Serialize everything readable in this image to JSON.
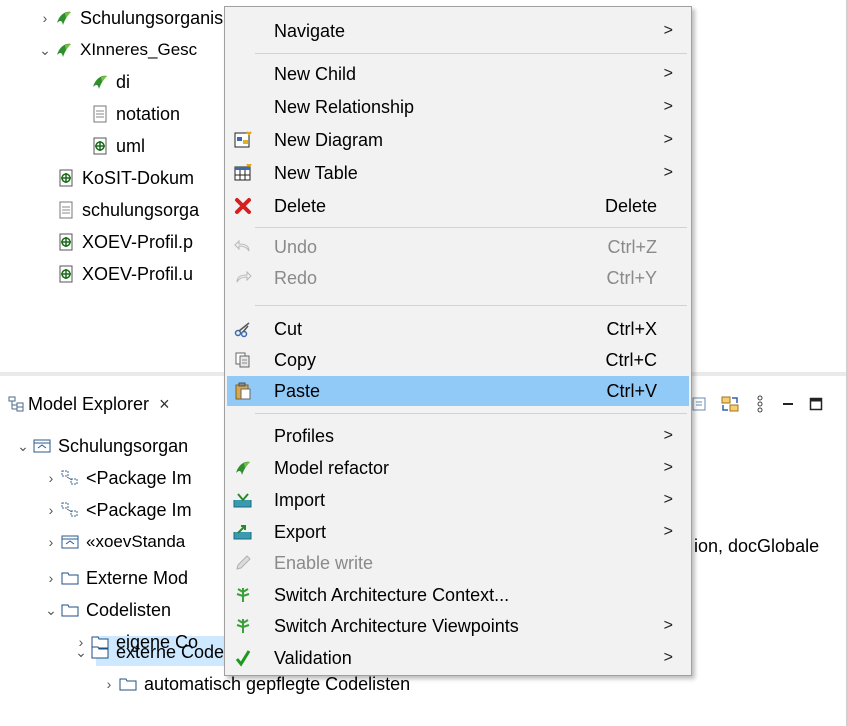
{
  "top_tree": [
    {
      "twisty": "›",
      "icon": "papyrus-icon",
      "label": "Schulungsorganisation"
    },
    {
      "twisty": "⌄",
      "icon": "papyrus-icon",
      "label": "XInneres_Gesc"
    },
    {
      "twisty": "",
      "icon": "papyrus-icon",
      "label": "di"
    },
    {
      "twisty": "",
      "icon": "text-file-icon",
      "label": "notation"
    },
    {
      "twisty": "",
      "icon": "uml-file-icon",
      "label": "uml"
    },
    {
      "twisty": "",
      "icon": "uml-file-icon",
      "label": "KoSIT-Dokum"
    },
    {
      "twisty": "",
      "icon": "text-file-icon",
      "label": "schulungsorga"
    },
    {
      "twisty": "",
      "icon": "uml-file-icon",
      "label": "XOEV-Profil.p"
    },
    {
      "twisty": "",
      "icon": "uml-file-icon",
      "label": "XOEV-Profil.u"
    }
  ],
  "model_explorer": {
    "tab_label": "Model Explorer",
    "close_glyph": "×",
    "tree": [
      {
        "twisty": "⌄",
        "icon": "model-icon",
        "label": "Schulungsorgan"
      },
      {
        "twisty": "›",
        "icon": "package-import-icon",
        "label": "<Package Im"
      },
      {
        "twisty": "›",
        "icon": "package-import-icon",
        "label": "<Package Im"
      },
      {
        "twisty": "›",
        "icon": "model-icon",
        "label": "«xoevStanda"
      },
      {
        "twisty": "›",
        "icon": "folder-icon",
        "label": "Externe Mod"
      },
      {
        "twisty": "⌄",
        "icon": "folder-icon",
        "label": "Codelisten"
      },
      {
        "twisty": "›",
        "icon": "folder-icon",
        "label": "eigene Co"
      },
      {
        "twisty": "⌄",
        "icon": "folder-icon",
        "label": "externe Codelisten"
      },
      {
        "twisty": "›",
        "icon": "folder-icon",
        "label": "automatisch gepflegte Codelisten"
      }
    ],
    "right_overflow_text": "ion, docGlobale"
  },
  "context_menu": {
    "items": [
      {
        "label": "Navigate",
        "accel": "",
        "submenu": true,
        "icon": "",
        "disabled": false
      },
      {
        "label": "New Child",
        "accel": "",
        "submenu": true,
        "icon": "",
        "disabled": false
      },
      {
        "label": "New Relationship",
        "accel": "",
        "submenu": true,
        "icon": "",
        "disabled": false
      },
      {
        "label": "New Diagram",
        "accel": "",
        "submenu": true,
        "icon": "new-diagram-icon",
        "disabled": false
      },
      {
        "label": "New Table",
        "accel": "",
        "submenu": true,
        "icon": "new-table-icon",
        "disabled": false
      },
      {
        "label": "Delete",
        "accel": "Delete",
        "submenu": false,
        "icon": "delete-icon",
        "disabled": false
      },
      {
        "label": "Undo",
        "accel": "Ctrl+Z",
        "submenu": false,
        "icon": "undo-icon",
        "disabled": true
      },
      {
        "label": "Redo",
        "accel": "Ctrl+Y",
        "submenu": false,
        "icon": "redo-icon",
        "disabled": true
      },
      {
        "label": "Cut",
        "accel": "Ctrl+X",
        "submenu": false,
        "icon": "cut-icon",
        "disabled": false
      },
      {
        "label": "Copy",
        "accel": "Ctrl+C",
        "submenu": false,
        "icon": "copy-icon",
        "disabled": false
      },
      {
        "label": "Paste",
        "accel": "Ctrl+V",
        "submenu": false,
        "icon": "paste-icon",
        "disabled": false,
        "highlighted": true
      },
      {
        "label": "Profiles",
        "accel": "",
        "submenu": true,
        "icon": "",
        "disabled": false
      },
      {
        "label": "Model refactor",
        "accel": "",
        "submenu": true,
        "icon": "papyrus-icon",
        "disabled": false
      },
      {
        "label": "Import",
        "accel": "",
        "submenu": true,
        "icon": "import-icon",
        "disabled": false
      },
      {
        "label": "Export",
        "accel": "",
        "submenu": true,
        "icon": "export-icon",
        "disabled": false
      },
      {
        "label": "Enable write",
        "accel": "",
        "submenu": false,
        "icon": "pencil-icon",
        "disabled": true
      },
      {
        "label": "Switch Architecture Context...",
        "accel": "",
        "submenu": false,
        "icon": "architecture-icon",
        "disabled": false
      },
      {
        "label": "Switch Architecture Viewpoints",
        "accel": "",
        "submenu": true,
        "icon": "architecture-icon",
        "disabled": false
      },
      {
        "label": "Validation",
        "accel": "",
        "submenu": true,
        "icon": "checkmark-icon",
        "disabled": false
      }
    ],
    "submenu_glyph": ">"
  },
  "colors": {
    "highlight": "#91c9f7",
    "selection": "#cde8ff",
    "menu_bg": "#f2f2f2"
  }
}
